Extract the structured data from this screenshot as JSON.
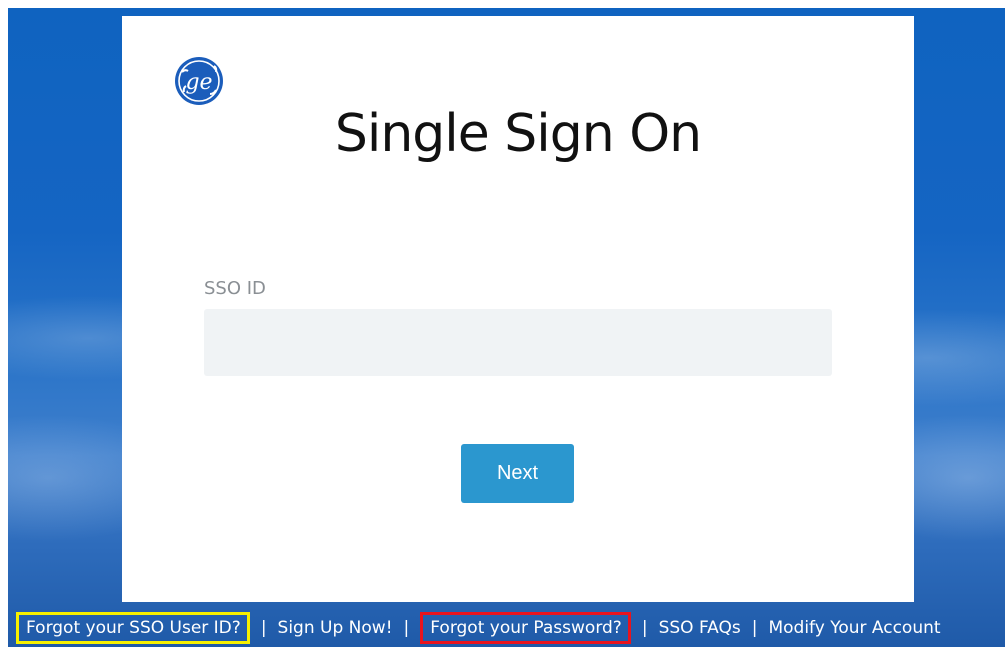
{
  "page": {
    "title": "Single Sign On"
  },
  "logo": {
    "icon": "ge-logo-icon",
    "color": "#1b5dbb"
  },
  "form": {
    "field_label": "SSO ID",
    "field_value": "",
    "field_placeholder": "",
    "next_label": "Next"
  },
  "footer": {
    "links": [
      {
        "label": "Forgot your SSO User ID?",
        "highlight": "#f6f000"
      },
      {
        "label": "Sign Up Now!"
      },
      {
        "label": "Forgot your Password?",
        "highlight": "#e8141e"
      },
      {
        "label": "SSO FAQs"
      },
      {
        "label": "Modify Your Account"
      }
    ],
    "separator": "|"
  },
  "colors": {
    "background": "#1565c3",
    "button": "#2b97cf",
    "input_bg": "#f0f3f5",
    "label": "#8a8f94"
  }
}
